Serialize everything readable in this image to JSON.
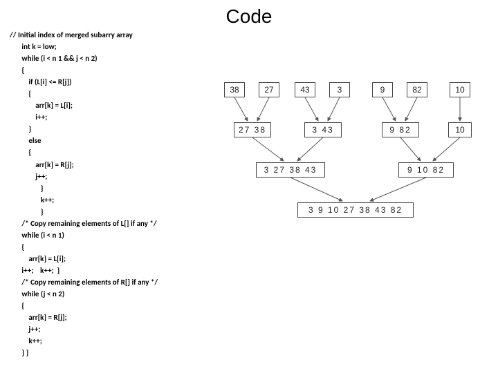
{
  "title": "Code",
  "code": {
    "l1": "// Initial index of merged subarry array",
    "l2": "       int k = low;",
    "l3": "       while (i < n 1 && j < n 2)",
    "l4": "       {",
    "l5": "           if (L[i] <= R[j])",
    "l6": "           {",
    "l7": "               arr[k] = L[i];",
    "l8": "               i++;",
    "l9": "           }",
    "l10": "           else",
    "l11": "           {",
    "l12": "               arr[k] = R[j];",
    "l13": "               j++;",
    "l14": "                  }",
    "l15": "                  k++;",
    "l16": "                  }",
    "l17": "       /* Copy remaining elements of L[] if any */",
    "l18": "       while (i < n 1)",
    "l19": "       {",
    "l20": "           arr[k] = L[i];",
    "l21": "       i++;    k++;  }",
    "l22": "       /* Copy remaining elements of R[] if any */",
    "l23": "       while (j < n 2)",
    "l24": "       {",
    "l25": "           arr[k] = R[j];",
    "l26": "           j++;",
    "l27": "           k++;",
    "l28": "       } }"
  },
  "diagram": {
    "row0": [
      "38",
      "27",
      "43",
      "3",
      "9",
      "82",
      "10"
    ],
    "row1_left": "27   38",
    "row1_mid": "3   43",
    "row1_r1": "9   82",
    "row1_r2": "10",
    "row2_left": "3   27   38   43",
    "row2_right": "9   10   82",
    "row3": "3   9   10   27   38   43   82"
  }
}
